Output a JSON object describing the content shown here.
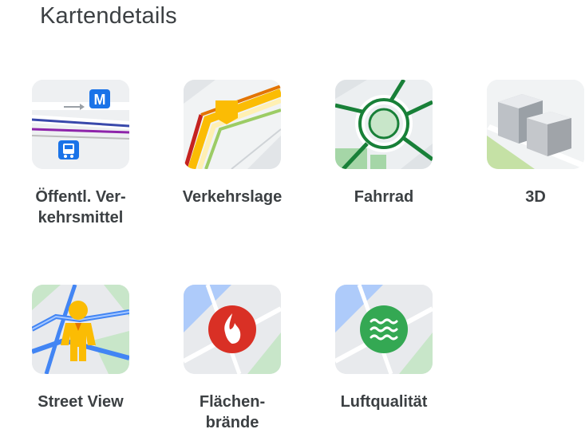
{
  "header": {
    "title": "Kartendetails"
  },
  "layers": [
    {
      "id": "transit",
      "label": "Öffentl. Ver-\nkehrsmittel",
      "icon": "transit-map-icon"
    },
    {
      "id": "traffic",
      "label": "Verkehrslage",
      "icon": "traffic-map-icon"
    },
    {
      "id": "bike",
      "label": "Fahrrad",
      "icon": "bike-map-icon"
    },
    {
      "id": "3d",
      "label": "3D",
      "icon": "buildings-3d-icon"
    },
    {
      "id": "streetview",
      "label": "Street View",
      "icon": "pegman-icon"
    },
    {
      "id": "wildfires",
      "label": "Flächen-\nbrände",
      "icon": "fire-icon"
    },
    {
      "id": "airquality",
      "label": "Luftqualität",
      "icon": "air-quality-icon"
    }
  ],
  "icons": {
    "metro_glyph": "M"
  },
  "colors": {
    "transit_blue": "#1a73e8",
    "traffic_yellow": "#fbbc04",
    "bike_green": "#188038",
    "fire_red": "#d93025",
    "air_green": "#34a853"
  }
}
